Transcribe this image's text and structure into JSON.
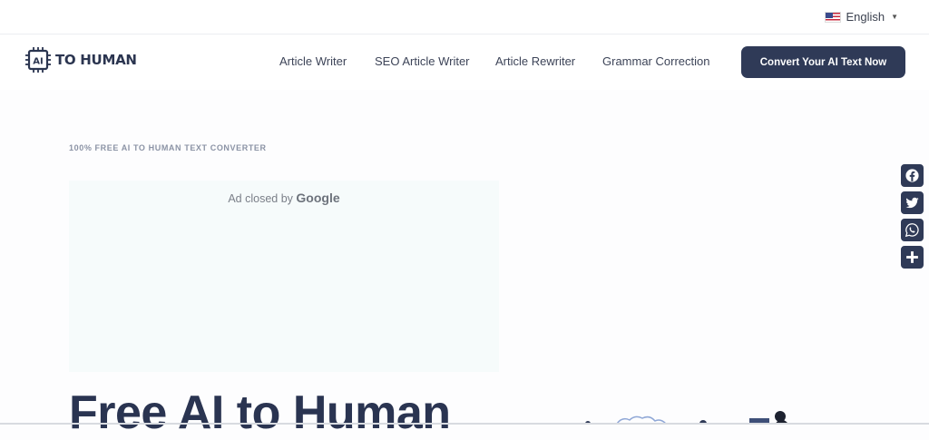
{
  "topbar": {
    "language": "English",
    "flag_icon": "us-flag-icon"
  },
  "header": {
    "logo_text": "TO HUMAN",
    "logo_chip_text": "AI",
    "nav": [
      {
        "label": "Article Writer"
      },
      {
        "label": "SEO Article Writer"
      },
      {
        "label": "Article Rewriter"
      },
      {
        "label": "Grammar Correction"
      }
    ],
    "cta_label": "Convert Your AI Text Now"
  },
  "hero": {
    "eyebrow": "100% FREE AI TO HUMAN TEXT CONVERTER",
    "title": "Free AI to Human"
  },
  "ad": {
    "text": "Ad closed by",
    "brand": "Google"
  },
  "social": {
    "icons": [
      "facebook-icon",
      "twitter-icon",
      "whatsapp-icon",
      "share-plus-icon"
    ]
  },
  "colors": {
    "brand_dark": "#2f3a57",
    "ad_background": "#f6fbfb",
    "eyebrow": "#8b93a5"
  }
}
